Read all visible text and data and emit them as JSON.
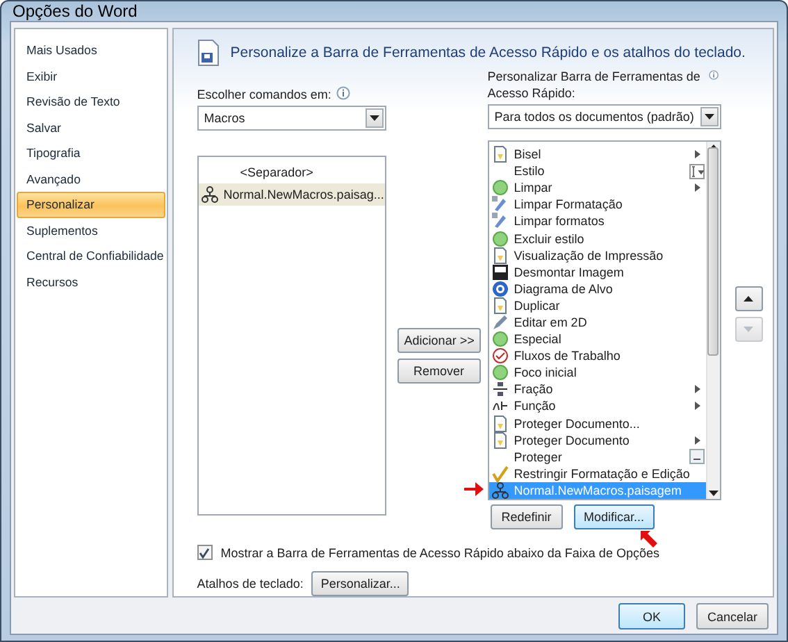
{
  "window": {
    "title": "Opções do Word"
  },
  "sidebar": {
    "items": [
      {
        "label": "Mais Usados",
        "selected": false
      },
      {
        "label": "Exibir",
        "selected": false
      },
      {
        "label": "Revisão de Texto",
        "selected": false
      },
      {
        "label": "Salvar",
        "selected": false
      },
      {
        "label": "Tipografia",
        "selected": false
      },
      {
        "label": "Avançado",
        "selected": false
      },
      {
        "label": "Personalizar",
        "selected": true
      },
      {
        "label": "Suplementos",
        "selected": false
      },
      {
        "label": "Central de Confiabilidade",
        "selected": false
      },
      {
        "label": "Recursos",
        "selected": false
      }
    ]
  },
  "header": "Personalize a Barra de Ferramentas de Acesso Rápido e os atalhos do teclado.",
  "commands": {
    "label": "Escolher comandos em:",
    "value": "Macros",
    "items": [
      {
        "label": "<Separador>",
        "icon": false,
        "selected": false
      },
      {
        "label": "Normal.NewMacros.paisag...",
        "icon": true,
        "selected": true
      }
    ]
  },
  "toolbar": {
    "label": "Personalizar Barra de Ferramentas de Acesso Rápido:",
    "value": "Para todos os documentos (padrão)",
    "items": [
      {
        "label": "Bisel",
        "kind": "submenu",
        "selected": false
      },
      {
        "label": "Estilo",
        "kind": "style",
        "selected": false
      },
      {
        "label": "Limpar",
        "kind": "submenu",
        "selected": false
      },
      {
        "label": "Limpar Formatação",
        "kind": "plain",
        "selected": false
      },
      {
        "label": "Limpar formatos",
        "kind": "plain",
        "selected": false
      },
      {
        "label": "Excluir estilo",
        "kind": "plain",
        "selected": false
      },
      {
        "label": "Visualização de Impressão",
        "kind": "plain",
        "selected": false
      },
      {
        "label": "Desmontar Imagem",
        "kind": "plain",
        "selected": false
      },
      {
        "label": "Diagrama de Alvo",
        "kind": "plain",
        "selected": false
      },
      {
        "label": "Duplicar",
        "kind": "plain",
        "selected": false
      },
      {
        "label": "Editar em 2D",
        "kind": "plain",
        "selected": false
      },
      {
        "label": "Especial",
        "kind": "plain",
        "selected": false
      },
      {
        "label": "Fluxos de Trabalho",
        "kind": "plain",
        "selected": false
      },
      {
        "label": "Foco inicial",
        "kind": "plain",
        "selected": false
      },
      {
        "label": "Fração",
        "kind": "submenu",
        "selected": false
      },
      {
        "label": "Função",
        "kind": "submenu",
        "selected": false
      },
      {
        "label": "Proteger Documento...",
        "kind": "plain",
        "selected": false
      },
      {
        "label": "Proteger Documento",
        "kind": "submenu",
        "selected": false
      },
      {
        "label": "Proteger",
        "kind": "more",
        "selected": false
      },
      {
        "label": "Restringir Formatação e Edição",
        "kind": "plain",
        "selected": false
      },
      {
        "label": "Normal.NewMacros.paisagem",
        "kind": "plain",
        "selected": true
      }
    ]
  },
  "middle_buttons": [
    {
      "label": "Adicionar >>",
      "disabled": false
    },
    {
      "label": "Remover",
      "disabled": false
    }
  ],
  "list_buttons": [
    {
      "label": "Redefinir"
    },
    {
      "label": "Modificar...",
      "hover": true
    }
  ],
  "show_below": {
    "label": "Mostrar a Barra de Ferramentas de Acesso Rápido abaixo da Faixa de Opções",
    "checked": true
  },
  "shortcuts": {
    "label": "Atalhos de teclado:",
    "button": "Personalizar..."
  },
  "footer_buttons": [
    "OK",
    "Cancelar"
  ]
}
